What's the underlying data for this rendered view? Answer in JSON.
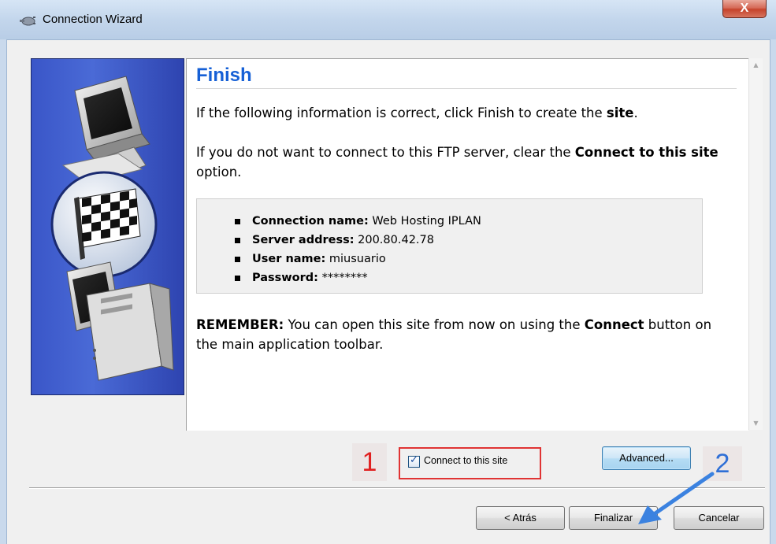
{
  "window": {
    "title": "Connection Wizard",
    "close_label": "X"
  },
  "page": {
    "heading": "Finish",
    "para1_pre": "If the following information is correct, click Finish to create the ",
    "para1_bold": "site",
    "para1_post": ".",
    "para2_pre": "If you do not want to connect to this FTP server, clear the ",
    "para2_bold": "Connect to this site",
    "para2_post": " option.",
    "details": [
      {
        "label": "Connection name:",
        "value": " Web Hosting IPLAN"
      },
      {
        "label": "Server address:",
        "value": " 200.80.42.78"
      },
      {
        "label": "User name:",
        "value": " miusuario"
      },
      {
        "label": "Password:",
        "value": " ********"
      }
    ],
    "remember_bold": "REMEMBER:",
    "remember_pre": " You can open this site from now on using the ",
    "remember_bold2": "Connect",
    "remember_post": " button on the main application toolbar."
  },
  "options": {
    "connect_checkbox_label": "Connect to this site",
    "connect_checked": true,
    "advanced_label": "Advanced..."
  },
  "annotations": {
    "step1": "1",
    "step2": "2"
  },
  "footer": {
    "back_label": "< Atrás",
    "finish_label": "Finalizar",
    "cancel_label": "Cancelar"
  },
  "colors": {
    "heading": "#1660d6",
    "annotation_red": "#e02020",
    "annotation_blue": "#2f6fd6",
    "art_panel": "#3a56c8"
  }
}
